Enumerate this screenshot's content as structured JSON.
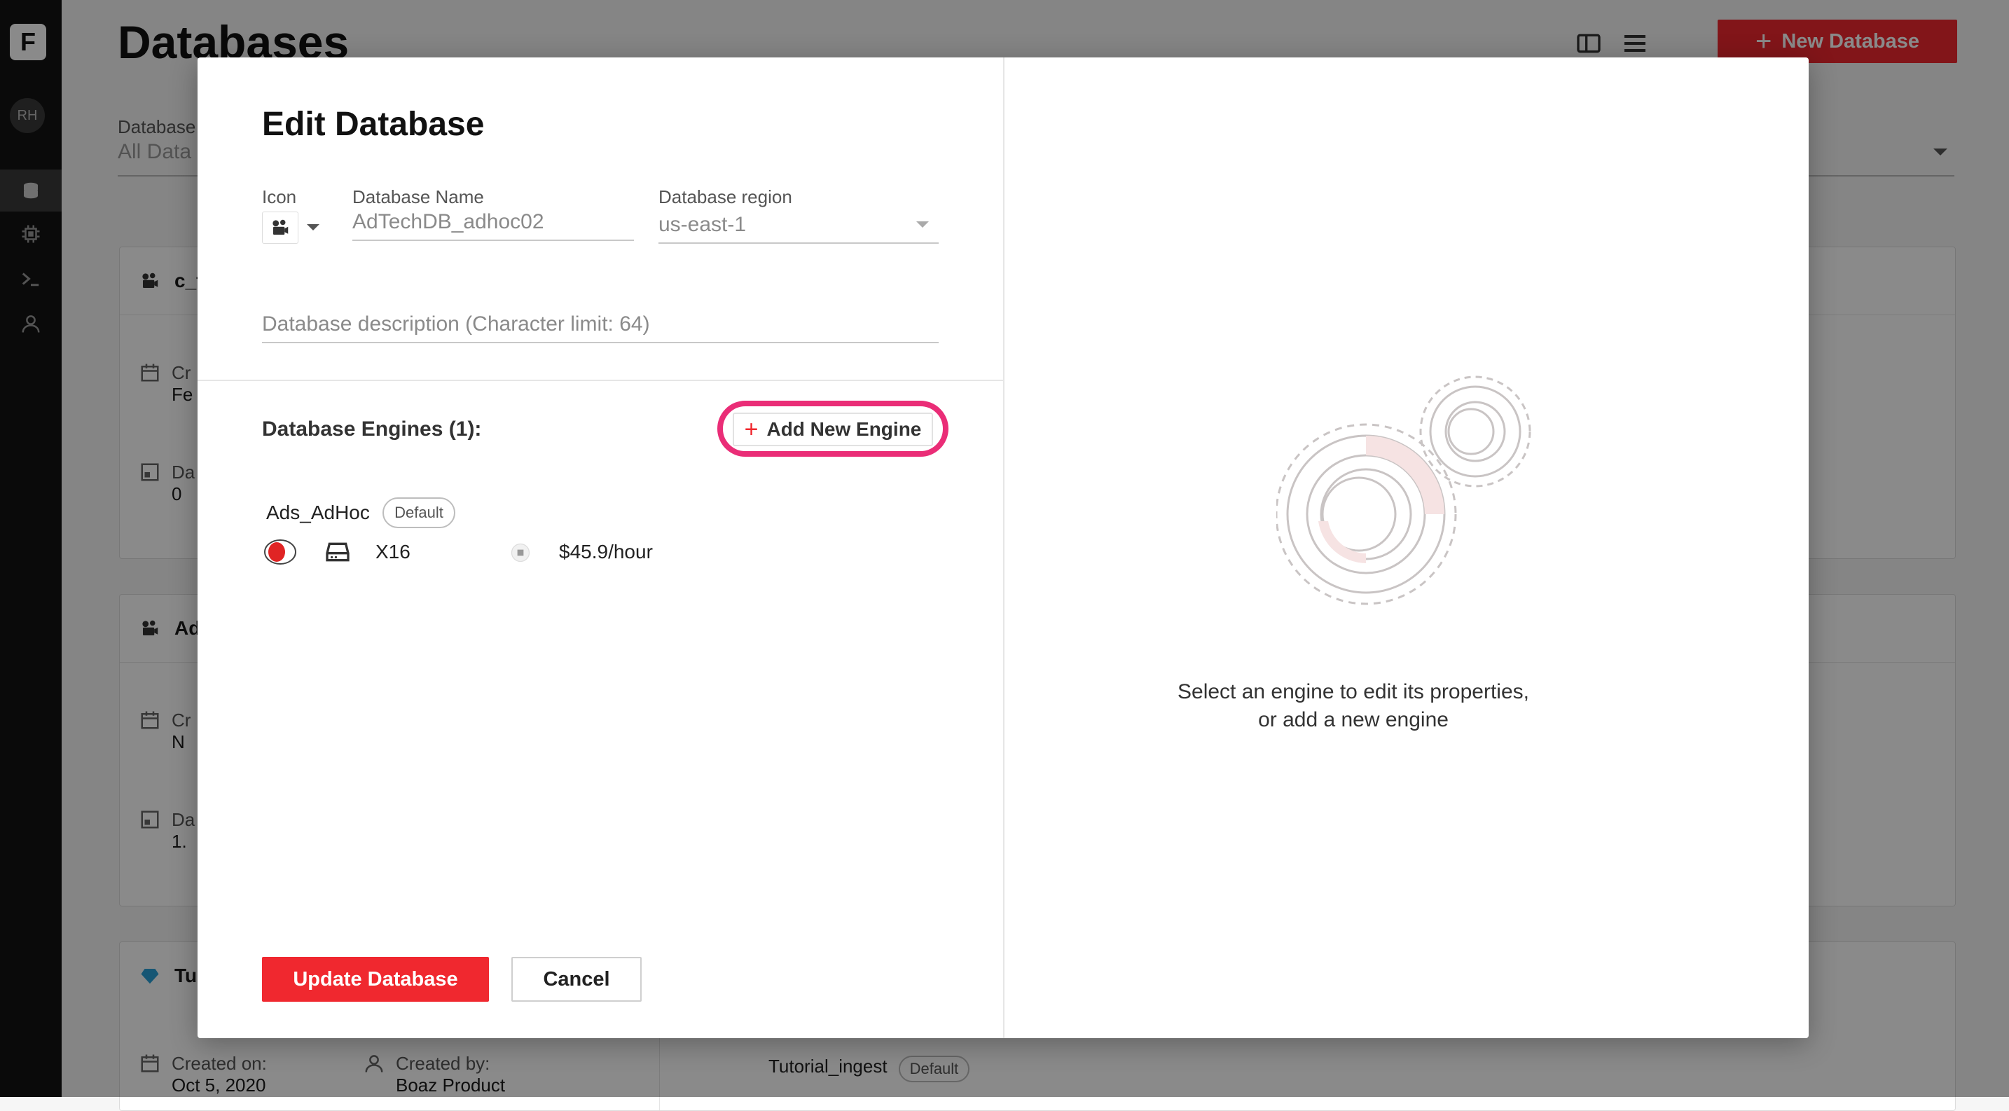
{
  "sidebar": {
    "logo": "F",
    "avatar_initials": "RH",
    "items": [
      {
        "icon": "database-icon",
        "active": true
      },
      {
        "icon": "chip-icon",
        "active": false
      },
      {
        "icon": "terminal-icon",
        "active": false
      },
      {
        "icon": "user-icon",
        "active": false
      }
    ]
  },
  "page": {
    "title": "Databases",
    "new_database_button": "New Database",
    "filter_label": "Database",
    "filter_value": "All Data",
    "cards": [
      {
        "name": "c_t",
        "row1_label": "Cr",
        "row1_value": "Fe",
        "row2_label": "Da",
        "row2_value": "0"
      },
      {
        "name": "Ad",
        "row1_label": "Cr",
        "row1_value": "N",
        "row2_label": "Da",
        "row2_value": "1."
      },
      {
        "name": "Tu",
        "row1_label": "Created on:",
        "row1_value": "Oct 5, 2020",
        "row2_label": "Created by:",
        "row2_value": "Boaz Product",
        "engine_name": "Tutorial_ingest",
        "engine_badge": "Default"
      }
    ]
  },
  "modal": {
    "title": "Edit Database",
    "icon_label": "Icon",
    "db_name_label": "Database Name",
    "db_name_value": "AdTechDB_adhoc02",
    "region_label": "Database region",
    "region_value": "us-east-1",
    "description_placeholder": "Database description (Character limit: 64)",
    "engines_label": "Database Engines (1):",
    "add_engine_button": "Add New Engine",
    "engine": {
      "name": "Ads_AdHoc",
      "badge": "Default",
      "size": "X16",
      "price": "$45.9/hour"
    },
    "update_button": "Update Database",
    "cancel_button": "Cancel",
    "empty_message_line1": "Select an engine to edit its properties,",
    "empty_message_line2": "or add a new engine"
  },
  "colors": {
    "accent": "#f0282f",
    "highlight_ring": "#ea2d77",
    "sidebar_bg": "#141414"
  }
}
